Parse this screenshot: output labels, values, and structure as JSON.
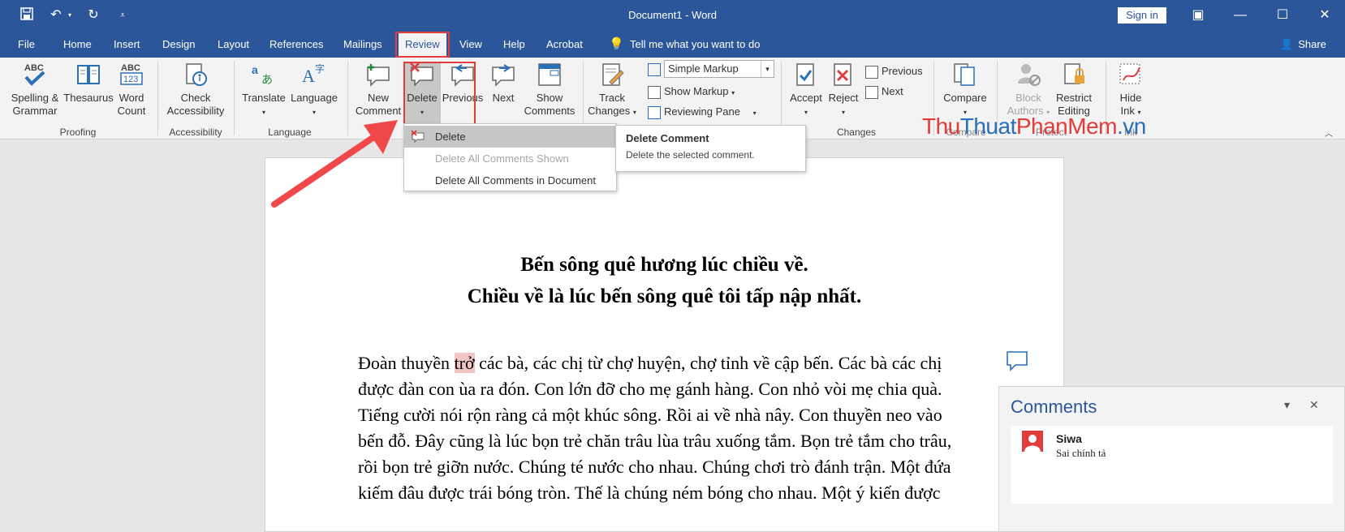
{
  "window": {
    "title": "Document1 - Word",
    "sign_in": "Sign in"
  },
  "tabs": [
    "File",
    "Home",
    "Insert",
    "Design",
    "Layout",
    "References",
    "Mailings",
    "Review",
    "View",
    "Help",
    "Acrobat"
  ],
  "active_tab": "Review",
  "tell_me": "Tell me what you want to do",
  "share": "Share",
  "ribbon": {
    "proofing": {
      "label": "Proofing",
      "spelling": [
        "Spelling &",
        "Grammar"
      ],
      "thesaurus": "Thesaurus",
      "word_count": [
        "Word",
        "Count"
      ]
    },
    "accessibility": {
      "label": "Accessibility",
      "check": [
        "Check",
        "Accessibility"
      ]
    },
    "language": {
      "label": "Language",
      "translate": "Translate",
      "language": "Language"
    },
    "comments": {
      "new_comment": [
        "New",
        "Comment"
      ],
      "delete": "Delete",
      "previous": "Previous",
      "next": "Next",
      "show_comments": [
        "Show",
        "Comments"
      ]
    },
    "tracking": {
      "track_changes": [
        "Track",
        "Changes"
      ],
      "markup_combo": "Simple Markup",
      "show_markup": "Show Markup",
      "reviewing_pane": "Reviewing Pane"
    },
    "changes": {
      "label": "Changes",
      "accept": "Accept",
      "reject": "Reject",
      "previous": "Previous",
      "next": "Next"
    },
    "compare": {
      "label": "Compare",
      "compare": "Compare"
    },
    "protect": {
      "label": "Protect",
      "block_authors": [
        "Block",
        "Authors"
      ],
      "restrict_editing": [
        "Restrict",
        "Editing"
      ]
    },
    "ink": {
      "label": "Ink",
      "hide_ink": [
        "Hide",
        "Ink"
      ]
    }
  },
  "delete_menu": {
    "items": [
      {
        "label": "Delete",
        "state": "selected"
      },
      {
        "label": "Delete All Comments Shown",
        "state": "disabled"
      },
      {
        "label": "Delete All Comments in Document",
        "state": "normal"
      }
    ]
  },
  "tooltip": {
    "title": "Delete Comment",
    "body": "Delete the selected comment."
  },
  "watermark": {
    "part1": "Thu",
    "part2": "Thuat",
    "part3": "PhanMem",
    "part4": ".vn"
  },
  "document": {
    "heading1": "Bến sông quê hương lúc chiều về.",
    "heading2": "Chiều về là lúc bến sông quê tôi tấp nập nhất.",
    "para_before": "Đoàn thuyền ",
    "para_highlight": "trở",
    "para_after": " các bà, các chị từ chợ huyện, chợ tỉnh về cập bến. Các bà các chị được đàn con ùa ra đón. Con lớn đỡ cho mẹ gánh hàng. Con nhỏ vòi mẹ chia quà. Tiếng cười nói rộn ràng cả một khúc sông. Rồi ai về nhà nây. Con thuyền neo vào bến đỗ. Đây cũng là lúc bọn trẻ chăn trâu lùa trâu xuống tắm. Bọn trẻ tắm cho trâu, rồi bọn trẻ giỡn nước. Chúng té nước cho nhau. Chúng chơi trò đánh trận. Một đứa kiếm đâu được trái bóng tròn. Thế là chúng ném bóng cho nhau. Một ý kiến được"
  },
  "comments_pane": {
    "title": "Comments",
    "author": "Siwa",
    "text": "Sai chính tả"
  },
  "colors": {
    "brand": "#2b579a",
    "highlight_outline": "#e53b3b",
    "comment_highlight": "#f2c4c4",
    "watermark_red": "#e03c3c",
    "watermark_blue": "#2b6fb6"
  }
}
